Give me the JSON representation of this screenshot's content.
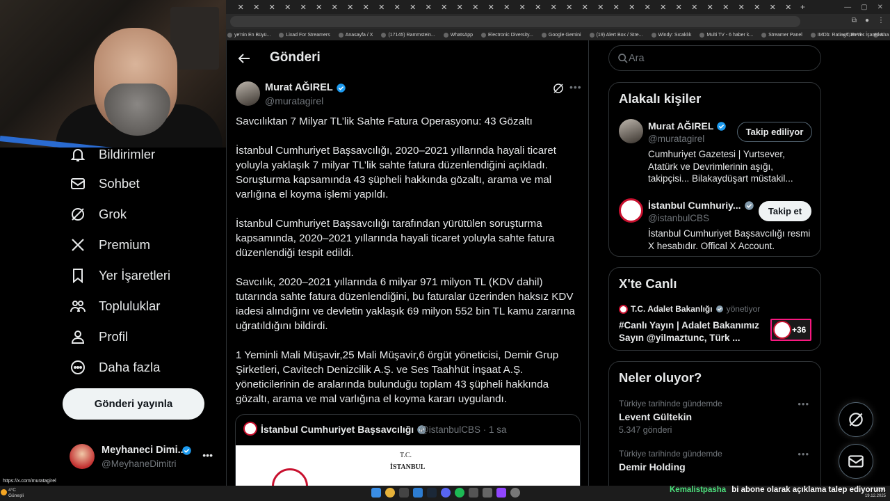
{
  "browser": {
    "tab_close_glyph": "✕",
    "tab_count": 36,
    "new_tab": "+",
    "bookmarks": [
      "ye'nin En Büyü...",
      "Lixad For Streamers",
      "Anasayfa / X",
      "(17145) Rammstein...",
      "WhatsApp",
      "Electronic Diversity...",
      "Google Gemini",
      "(19) Alert Box / Stre...",
      "Windy: Sıcaklık",
      "Multi TV - 6 haber k...",
      "Streamer Panel",
      "IMDb: Ratings, Revi...",
      "Ana Sayfa • HBO Max"
    ],
    "bookmarks_more": "»",
    "all_bookmarks": "Tüm Yer İşaretleri",
    "status_url": "https://x.com/muratagirel"
  },
  "nav": {
    "items": [
      {
        "label": "Bildirimler",
        "icon": "bell-icon"
      },
      {
        "label": "Sohbet",
        "icon": "mail-icon"
      },
      {
        "label": "Grok",
        "icon": "grok-icon"
      },
      {
        "label": "Premium",
        "icon": "x-logo-icon"
      },
      {
        "label": "Yer İşaretleri",
        "icon": "bookmark-icon"
      },
      {
        "label": "Topluluklar",
        "icon": "communities-icon"
      },
      {
        "label": "Profil",
        "icon": "profile-icon"
      },
      {
        "label": "Daha fazla",
        "icon": "more-circle-icon"
      }
    ],
    "post_button": "Gönderi yayınla",
    "account": {
      "name": "Meyhaneci Dimi...",
      "handle": "@MeyhaneDimitri",
      "more": "•••"
    }
  },
  "main": {
    "title": "Gönderi",
    "author": {
      "name": "Murat AĞIREL",
      "handle": "@muratagirel"
    },
    "more": "•••",
    "paragraphs": [
      "Savcılıktan 7 Milyar TL’lik Sahte Fatura Operasyonu: 43 Gözaltı",
      "İstanbul Cumhuriyet Başsavcılığı, 2020–2021 yıllarında hayali ticaret yoluyla yaklaşık 7 milyar TL’lik sahte fatura düzenlendiğini açıkladı. Soruşturma kapsamında 43 şüpheli hakkında gözaltı, arama ve mal varlığına el koyma işlemi yapıldı.",
      "İstanbul Cumhuriyet Başsavcılığı tarafından yürütülen soruşturma kapsamında, 2020–2021 yıllarında hayali ticaret yoluyla sahte fatura düzenlendiği tespit edildi.",
      "Savcılık, 2020–2021 yıllarında 6 milyar 971 milyon TL (KDV dahil) tutarında sahte fatura düzenlendiğini, bu faturalar üzerinden haksız KDV iadesi alındığını ve devletin yaklaşık 69 milyon 552 bin TL kamu zararına uğratıldığını bildirdi.",
      "1 Yeminli Mali Müşavir,25 Mali Müşavir,6 örgüt yöneticisi, Demir Grup Şirketleri, Cavitech Denizcilik A.Ş. ve Ses Taahhüt İnşaat A.Ş. yöneticilerinin de aralarında bulunduğu toplam 43 şüpheli hakkında gözaltı, arama ve mal varlığına el koyma kararı uygulandı."
    ],
    "quote": {
      "name": "İstanbul Cumhuriyet Başsavcılığı",
      "handle": "@istanbulCBS",
      "time": "· 1 sa",
      "image_text_1": "T.C.",
      "image_text_2": "İSTANBUL"
    }
  },
  "sidebar": {
    "search_placeholder": "Ara",
    "related": {
      "title": "Alakalı kişiler",
      "people": [
        {
          "name": "Murat AĞIREL",
          "handle": "@muratagirel",
          "button": "Takip ediliyor",
          "bio": "Cumhuriyet Gazetesi | Yurtsever, Atatürk ve Devrimlerinin aşığı, takipçisi... Bilakaydüşart müstakil..."
        },
        {
          "name": "İstanbul Cumhuriy...",
          "handle": "@istanbulCBS",
          "button": "Takip et",
          "bio": "İstanbul Cumhuriyet Başsavcılığı resmi X hesabıdır. Offical X Account."
        }
      ]
    },
    "live": {
      "title": "X'te Canlı",
      "host": "T.C. Adalet Bakanlığı",
      "role": "yönetiyor",
      "stream_title": "#Canlı Yayın | Adalet Bakanımız Sayın @yilmaztunc, Türk ...",
      "count": "+36"
    },
    "trends": {
      "title": "Neler oluyor?",
      "items": [
        {
          "context": "Türkiye tarihinde gündemde",
          "name": "Levent Gültekin",
          "count": "5.347 gönderi"
        },
        {
          "context": "Türkiye tarihinde gündemde",
          "name": "Demir Holding",
          "count": ""
        }
      ],
      "more": "•••"
    }
  },
  "taskbar": {
    "weather_temp": "4°C",
    "weather_desc": "Güneşli",
    "time": "10:41",
    "date": "19.12.2025"
  },
  "chat": {
    "user": "Kemalistpasha",
    "message": "bi abone olarak açıklama talep ediyorum"
  },
  "colors": {
    "background": "#000000",
    "text": "#e7e9ea",
    "muted": "#71767b",
    "border": "#2f3336",
    "verified": "#1d9bf0",
    "live_pink": "#f91880",
    "chat_user": "#4ce07c"
  }
}
